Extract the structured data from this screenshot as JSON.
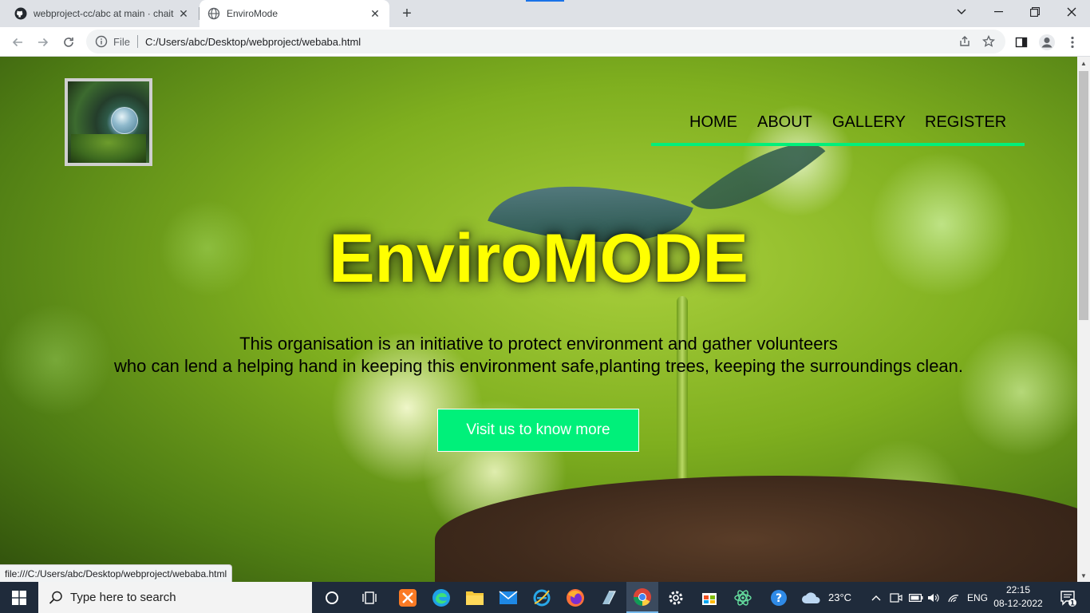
{
  "browser": {
    "tabs": [
      {
        "title": "webproject-cc/abc at main · chait",
        "icon": "github-icon",
        "active": false
      },
      {
        "title": "EnviroMode",
        "icon": "globe-icon",
        "active": true
      }
    ],
    "window_controls": {
      "tab_search": "⌄",
      "minimize": "—",
      "restore": "❐",
      "close": "✕"
    },
    "address": {
      "scheme": "File",
      "url": "C:/Users/abc/Desktop/webproject/webaba.html"
    }
  },
  "page": {
    "nav": {
      "home": "HOME",
      "about": "ABOUT",
      "gallery": "GALLERY",
      "register": "REGISTER"
    },
    "title": "EnviroMODE",
    "description_line1": "This organisation is an initiative to protect environment and gather volunteers",
    "description_line2": "who can lend a helping hand in keeping this environment safe,planting trees, keeping the surroundings clean.",
    "cta_label": "Visit us to know more",
    "status_url": "file:///C:/Users/abc/Desktop/webproject/webaba.html",
    "colors": {
      "title": "#ffff00",
      "accent": "#00f07a"
    }
  },
  "taskbar": {
    "search_placeholder": "Type here to search",
    "weather": "23°C",
    "language": "ENG",
    "time": "22:15",
    "date": "08-12-2022",
    "notification_count": "1"
  }
}
